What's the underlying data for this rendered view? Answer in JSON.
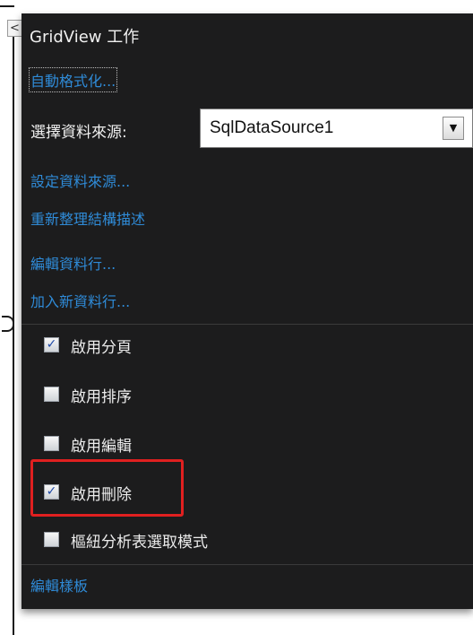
{
  "panel": {
    "title": "GridView 工作",
    "collapse_glyph": "<"
  },
  "actions": {
    "auto_format": "自動格式化...",
    "choose_ds_label": "選擇資料來源:",
    "datasource_value": "SqlDataSource1",
    "configure_ds": "設定資料來源...",
    "refresh_schema": "重新整理結構描述",
    "edit_columns": "編輯資料行...",
    "add_column": "加入新資料行...",
    "edit_templates": "編輯樣板"
  },
  "options": [
    {
      "label": "啟用分頁",
      "checked": true
    },
    {
      "label": "啟用排序",
      "checked": false
    },
    {
      "label": "啟用編輯",
      "checked": false
    },
    {
      "label": "啟用刪除",
      "checked": true
    },
    {
      "label": "樞紐分析表選取模式",
      "checked": false
    }
  ],
  "icons": {
    "dropdown_arrow": "chevron-down-icon",
    "check_mark": "check-icon"
  },
  "colors": {
    "panel_bg": "#1c1c1d",
    "link": "#2f8bd8",
    "highlight": "#e02020"
  }
}
